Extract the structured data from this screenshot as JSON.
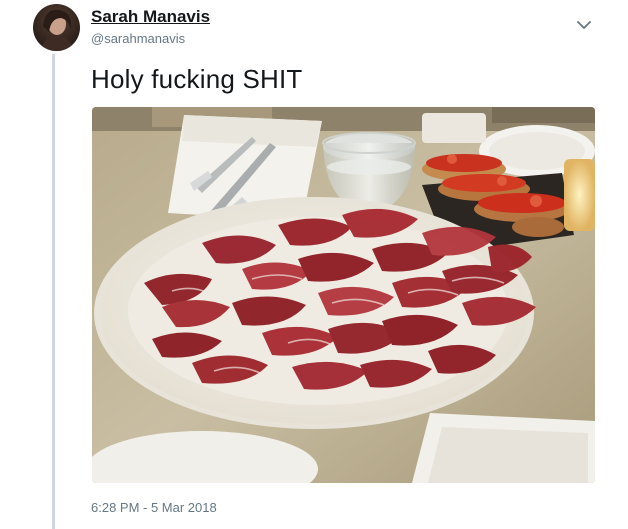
{
  "tweet": {
    "author_name": "Sarah Manavis",
    "author_handle": "@sarahmanavis",
    "text": "Holy fucking SHIT",
    "timestamp": "6:28 PM - 5 Mar 2018",
    "photo_subject": "plate of sliced cured ham on a restaurant table"
  },
  "icons": {
    "menu_caret": "chevron-down-icon"
  },
  "colors": {
    "name": "#14171a",
    "secondary_text": "#657786",
    "thread_line": "#d0d6db"
  }
}
